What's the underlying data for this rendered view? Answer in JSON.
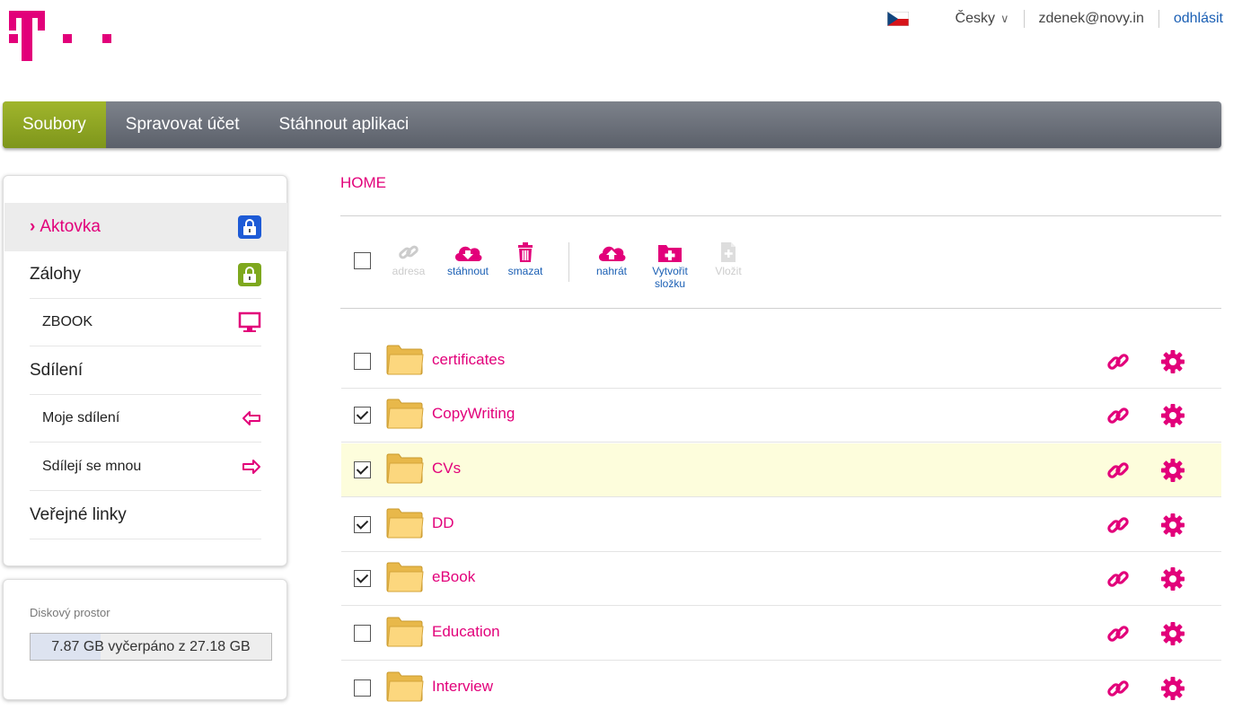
{
  "header": {
    "logo": "T-logo",
    "flag_icon": "czech-flag-icon",
    "language": "Česky",
    "user": "zdenek@novy.in",
    "logout": "odhlásit"
  },
  "nav": {
    "tabs": [
      {
        "label": "Soubory",
        "active": true
      },
      {
        "label": "Spravovat účet",
        "active": false
      },
      {
        "label": "Stáhnout aplikaci",
        "active": false
      }
    ]
  },
  "sidebar": {
    "items": [
      {
        "label": "Aktovka",
        "icon": "lock-icon",
        "active": true
      },
      {
        "label": "Zálohy",
        "icon": "lock-icon"
      },
      {
        "label": "ZBOOK",
        "icon": "monitor-icon"
      },
      {
        "label": "Sdílení"
      },
      {
        "label": "Moje sdílení",
        "icon": "arrow-left-icon"
      },
      {
        "label": "Sdílejí se mnou",
        "icon": "arrow-right-icon"
      },
      {
        "label": "Veřejné linky"
      }
    ],
    "colors": {
      "blue_lock": "#1e5bd6",
      "green_lock": "#7ea81e",
      "accent": "#e2007a"
    }
  },
  "disk": {
    "label": "Diskový prostor",
    "usage_text": "7.87 GB vyčerpáno z 27.18 GB",
    "used_fraction": 0.29
  },
  "main": {
    "breadcrumb": "HOME",
    "toolbar": {
      "adresa": "adresa",
      "stahnout": "stáhnout",
      "smazat": "smazat",
      "nahrat": "nahrát",
      "vytvorit_line1": "Vytvořit",
      "vytvorit_line2": "složku",
      "vlozit": "Vložit"
    },
    "folders": [
      {
        "name": "certificates",
        "checked": false
      },
      {
        "name": "CopyWriting",
        "checked": true
      },
      {
        "name": "CVs",
        "checked": true,
        "highlighted": true
      },
      {
        "name": "DD",
        "checked": true
      },
      {
        "name": "eBook",
        "checked": true
      },
      {
        "name": "Education",
        "checked": false
      },
      {
        "name": "Interview",
        "checked": false
      }
    ]
  }
}
